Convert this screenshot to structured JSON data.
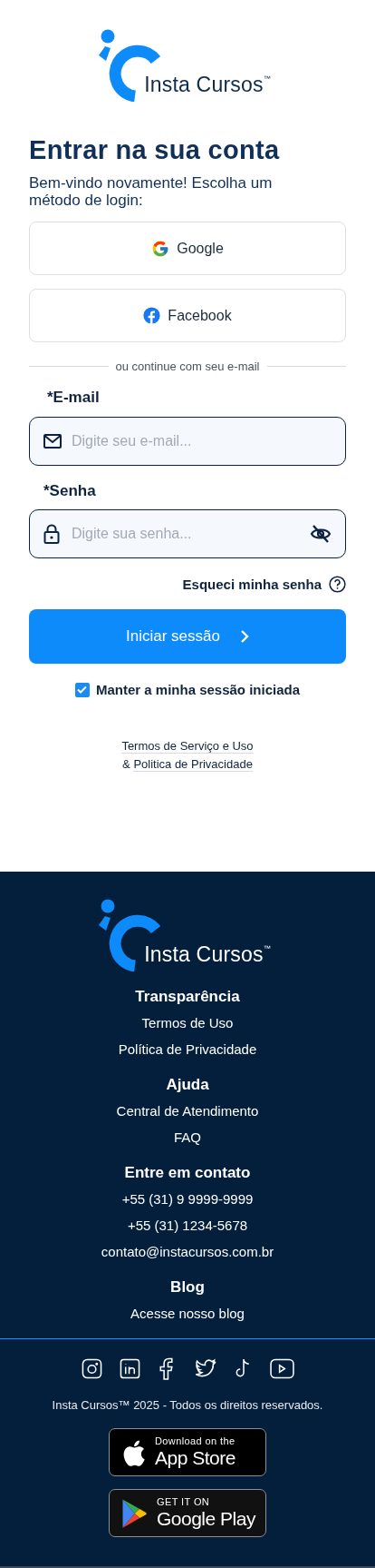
{
  "header": {
    "logo": {
      "brand": "Insta Cursos$^{™}$"
    }
  },
  "login": {
    "title": "Entrar na sua conta",
    "subtitle": "Bem-vindo novamente! Escolha um método de login:",
    "social_buttons": [
      {
        "kind": "google",
        "label": "Google"
      },
      {
        "kind": "facebook",
        "label": "Facebook"
      }
    ],
    "divider": "ou continue com seu e-mail",
    "fields": [
      {
        "kind": "email",
        "label": "*E-mail",
        "placeholder": "Digite seu e-mail..."
      },
      {
        "kind": "password",
        "label": "*Senha",
        "placeholder": "Digite sua senha...",
        "password_hidden": true
      }
    ],
    "forgot_link": "Esqueci minha senha",
    "submit": "Iniciar sessão",
    "remember": {
      "label": "Manter a minha sessão iniciada",
      "checked": true
    },
    "terms": {
      "terms_link": "Termos de Serviço e Uso",
      "joiner": "&",
      "privacy_link": "Politica de Privacidade"
    }
  },
  "footer": {
    "logo": {
      "brand": "Insta Cursos$^{™}$"
    },
    "sections": [
      {
        "heading": "Transparência",
        "links": [
          "Termos de Uso",
          "Política de Privacidade"
        ]
      },
      {
        "heading": "Ajuda",
        "links": [
          "Central de Atendimento",
          "FAQ"
        ]
      },
      {
        "heading": "Entre em contato",
        "links": [
          "+55 (31) 9 9999-9999",
          "+55 (31) 1234-5678",
          "contato@instacursos.com.br"
        ]
      },
      {
        "heading": "Blog",
        "links": [
          "Acesse nosso blog"
        ]
      }
    ],
    "copyright": "Insta Cursos™ 2025 - Todos os direitos reservados.",
    "store_badges": [
      {
        "kind": "app_store",
        "caption": "Download on the",
        "store": "App Store"
      },
      {
        "kind": "google_play",
        "caption": "GET IT ON",
        "store": "Google Play"
      }
    ]
  }
}
